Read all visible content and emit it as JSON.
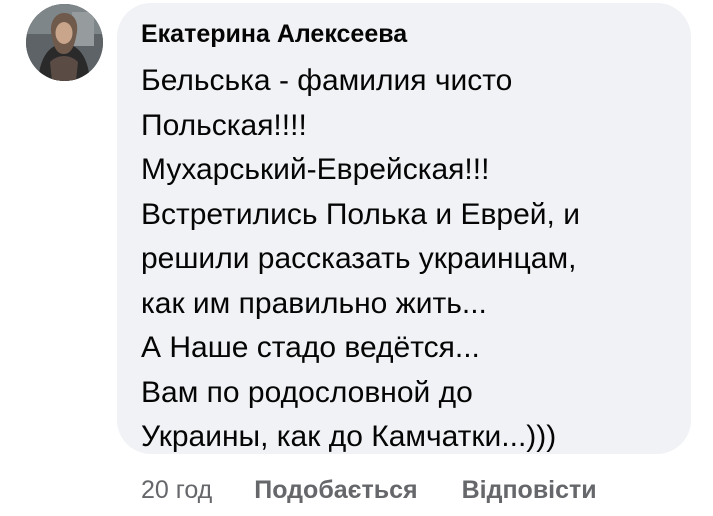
{
  "comment": {
    "author": "Екатерина Алексеева",
    "lines": [
      "Бельська - фамилия чисто",
      "Польская!!!!",
      "Мухарський-Еврейская!!!",
      "Встретились Полька и Еврей, и",
      "решили рассказать украинцам,",
      "как им правильно жить...",
      "А Наше стадо ведётся...",
      "Вам по родословной до",
      "Украины, как до Камчатки...)))"
    ],
    "timestamp": "20 год",
    "like_label": "Подобається",
    "reply_label": "Відповісти"
  },
  "colors": {
    "bubble_background": "#f0f2f5",
    "text": "#050505",
    "secondary_text": "#65676b"
  }
}
